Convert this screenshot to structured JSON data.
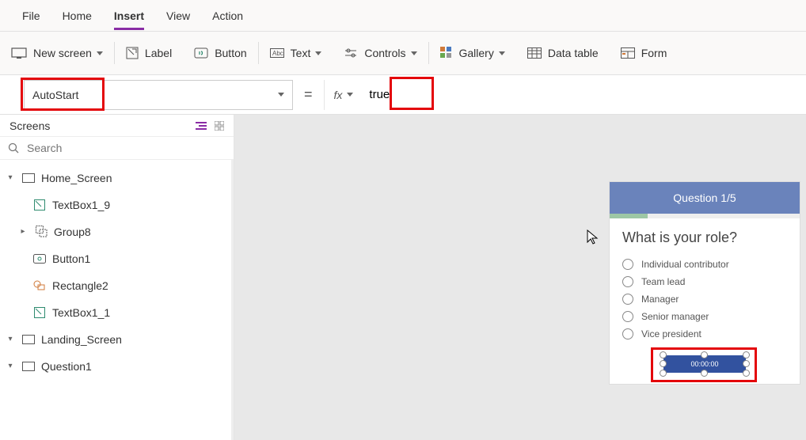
{
  "menu": {
    "file": "File",
    "home": "Home",
    "insert": "Insert",
    "view": "View",
    "action": "Action"
  },
  "ribbon": {
    "new_screen": "New screen",
    "label": "Label",
    "button": "Button",
    "text": "Text",
    "controls": "Controls",
    "gallery": "Gallery",
    "data_table": "Data table",
    "forms": "Form"
  },
  "formula": {
    "property": "AutoStart",
    "value": "true"
  },
  "tree": {
    "title": "Screens",
    "search_placeholder": "Search",
    "nodes": {
      "home": "Home_Screen",
      "tb19": "TextBox1_9",
      "group8": "Group8",
      "button1": "Button1",
      "rect2": "Rectangle2",
      "tb11": "TextBox1_1",
      "landing": "Landing_Screen",
      "q1": "Question1"
    }
  },
  "preview": {
    "header": "Question 1/5",
    "question": "What is your role?",
    "options": [
      "Individual contributor",
      "Team lead",
      "Manager",
      "Senior manager",
      "Vice president"
    ],
    "timer": "00:00:00"
  }
}
